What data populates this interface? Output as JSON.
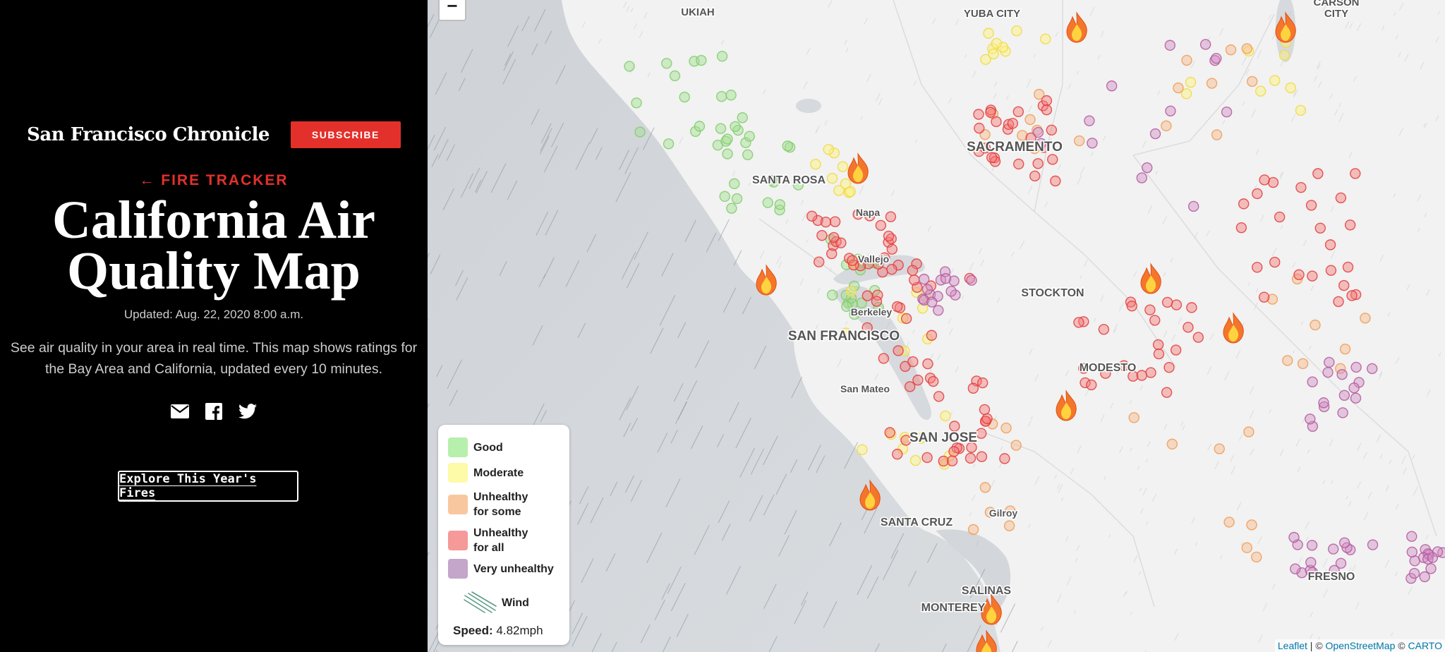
{
  "header": {
    "brand": "San Francisco Chronicle",
    "subscribe_label": "SUBSCRIBE",
    "back_link": "← FIRE TRACKER"
  },
  "page": {
    "title": "California Air Quality Map",
    "updated": "Updated: Aug. 22, 2020 8:00 a.m.",
    "description": "See air quality in your area in real time. This map shows ratings for the Bay Area and California, updated every 10 minutes.",
    "explore_label": "Explore This Year's Fires"
  },
  "share_icons": [
    "email-icon",
    "facebook-icon",
    "twitter-icon"
  ],
  "map": {
    "zoom_out_label": "−",
    "cities": [
      {
        "name": "UKIAH",
        "size": "sm"
      },
      {
        "name": "YUBA CITY",
        "size": "sm"
      },
      {
        "name": "CARSON",
        "size": "sm"
      },
      {
        "name": "CITY",
        "size": "sm"
      },
      {
        "name": "SACRAMENTO",
        "size": "lg"
      },
      {
        "name": "SANTA ROSA",
        "size": "md"
      },
      {
        "name": "Napa",
        "size": "xs"
      },
      {
        "name": "Vallejo",
        "size": "xs"
      },
      {
        "name": "STOCKTON",
        "size": "md"
      },
      {
        "name": "Berkeley",
        "size": "xs"
      },
      {
        "name": "SAN FRANCISCO",
        "size": "lg"
      },
      {
        "name": "MODESTO",
        "size": "md"
      },
      {
        "name": "San Mateo",
        "size": "xs"
      },
      {
        "name": "SAN JOSE",
        "size": "lg"
      },
      {
        "name": "SANTA CRUZ",
        "size": "md"
      },
      {
        "name": "Gilroy",
        "size": "xs"
      },
      {
        "name": "SALINAS",
        "size": "md"
      },
      {
        "name": "MONTEREY",
        "size": "md"
      },
      {
        "name": "FRESNO",
        "size": "md"
      }
    ],
    "fire_count": 10,
    "sensor_counts_by_rating": {
      "good": 55,
      "moderate": 45,
      "unhealthy_for_some": 40,
      "unhealthy_for_all": 150,
      "very_unhealthy": 75
    }
  },
  "legend": {
    "items": [
      {
        "label": "Good",
        "color": "#b7efac"
      },
      {
        "label": "Moderate",
        "color": "#fdfaa8"
      },
      {
        "label": "Unhealthy for some",
        "color": "#f9c79f"
      },
      {
        "label": "Unhealthy for all",
        "color": "#f59999"
      },
      {
        "label": "Very unhealthy",
        "color": "#c3a6c9"
      }
    ],
    "wind_label": "Wind",
    "speed_label": "Speed:",
    "speed_value": "4.82mph"
  },
  "attribution": {
    "leaflet": "Leaflet",
    "sep1": " | © ",
    "osm": "OpenStreetMap",
    "sep2": " © ",
    "carto": "CARTO"
  }
}
